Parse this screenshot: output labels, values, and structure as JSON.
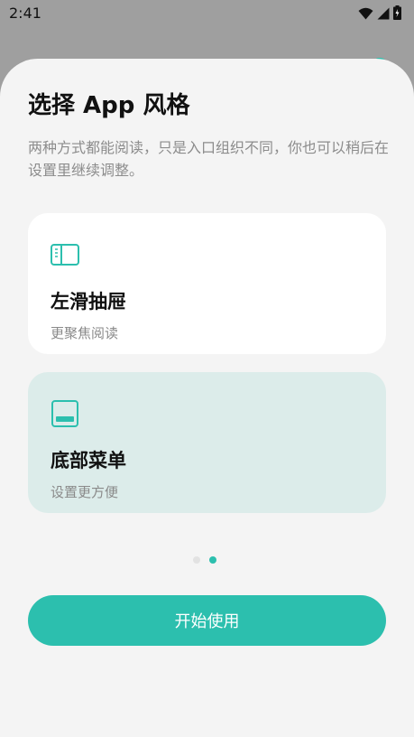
{
  "status_bar": {
    "time": "2:41",
    "icons": [
      "wifi-icon",
      "signal-icon",
      "battery-icon"
    ]
  },
  "sheet": {
    "title": "选择 App 风格",
    "subtitle": "两种方式都能阅读，只是入口组织不同，你也可以稍后在设置里继续调整。"
  },
  "options": [
    {
      "icon": "sidebar-drawer-icon",
      "title": "左滑抽屉",
      "description": "更聚焦阅读",
      "selected": false
    },
    {
      "icon": "bottom-menu-icon",
      "title": "底部菜单",
      "description": "设置更方便",
      "selected": true
    }
  ],
  "pager": {
    "total": 2,
    "current": 2
  },
  "actions": {
    "start_label": "开始使用"
  },
  "colors": {
    "accent": "#2cbfae",
    "selected_card": "#dcecea",
    "sheet_background": "#f4f4f4",
    "scrim": "#9f9f9f"
  }
}
